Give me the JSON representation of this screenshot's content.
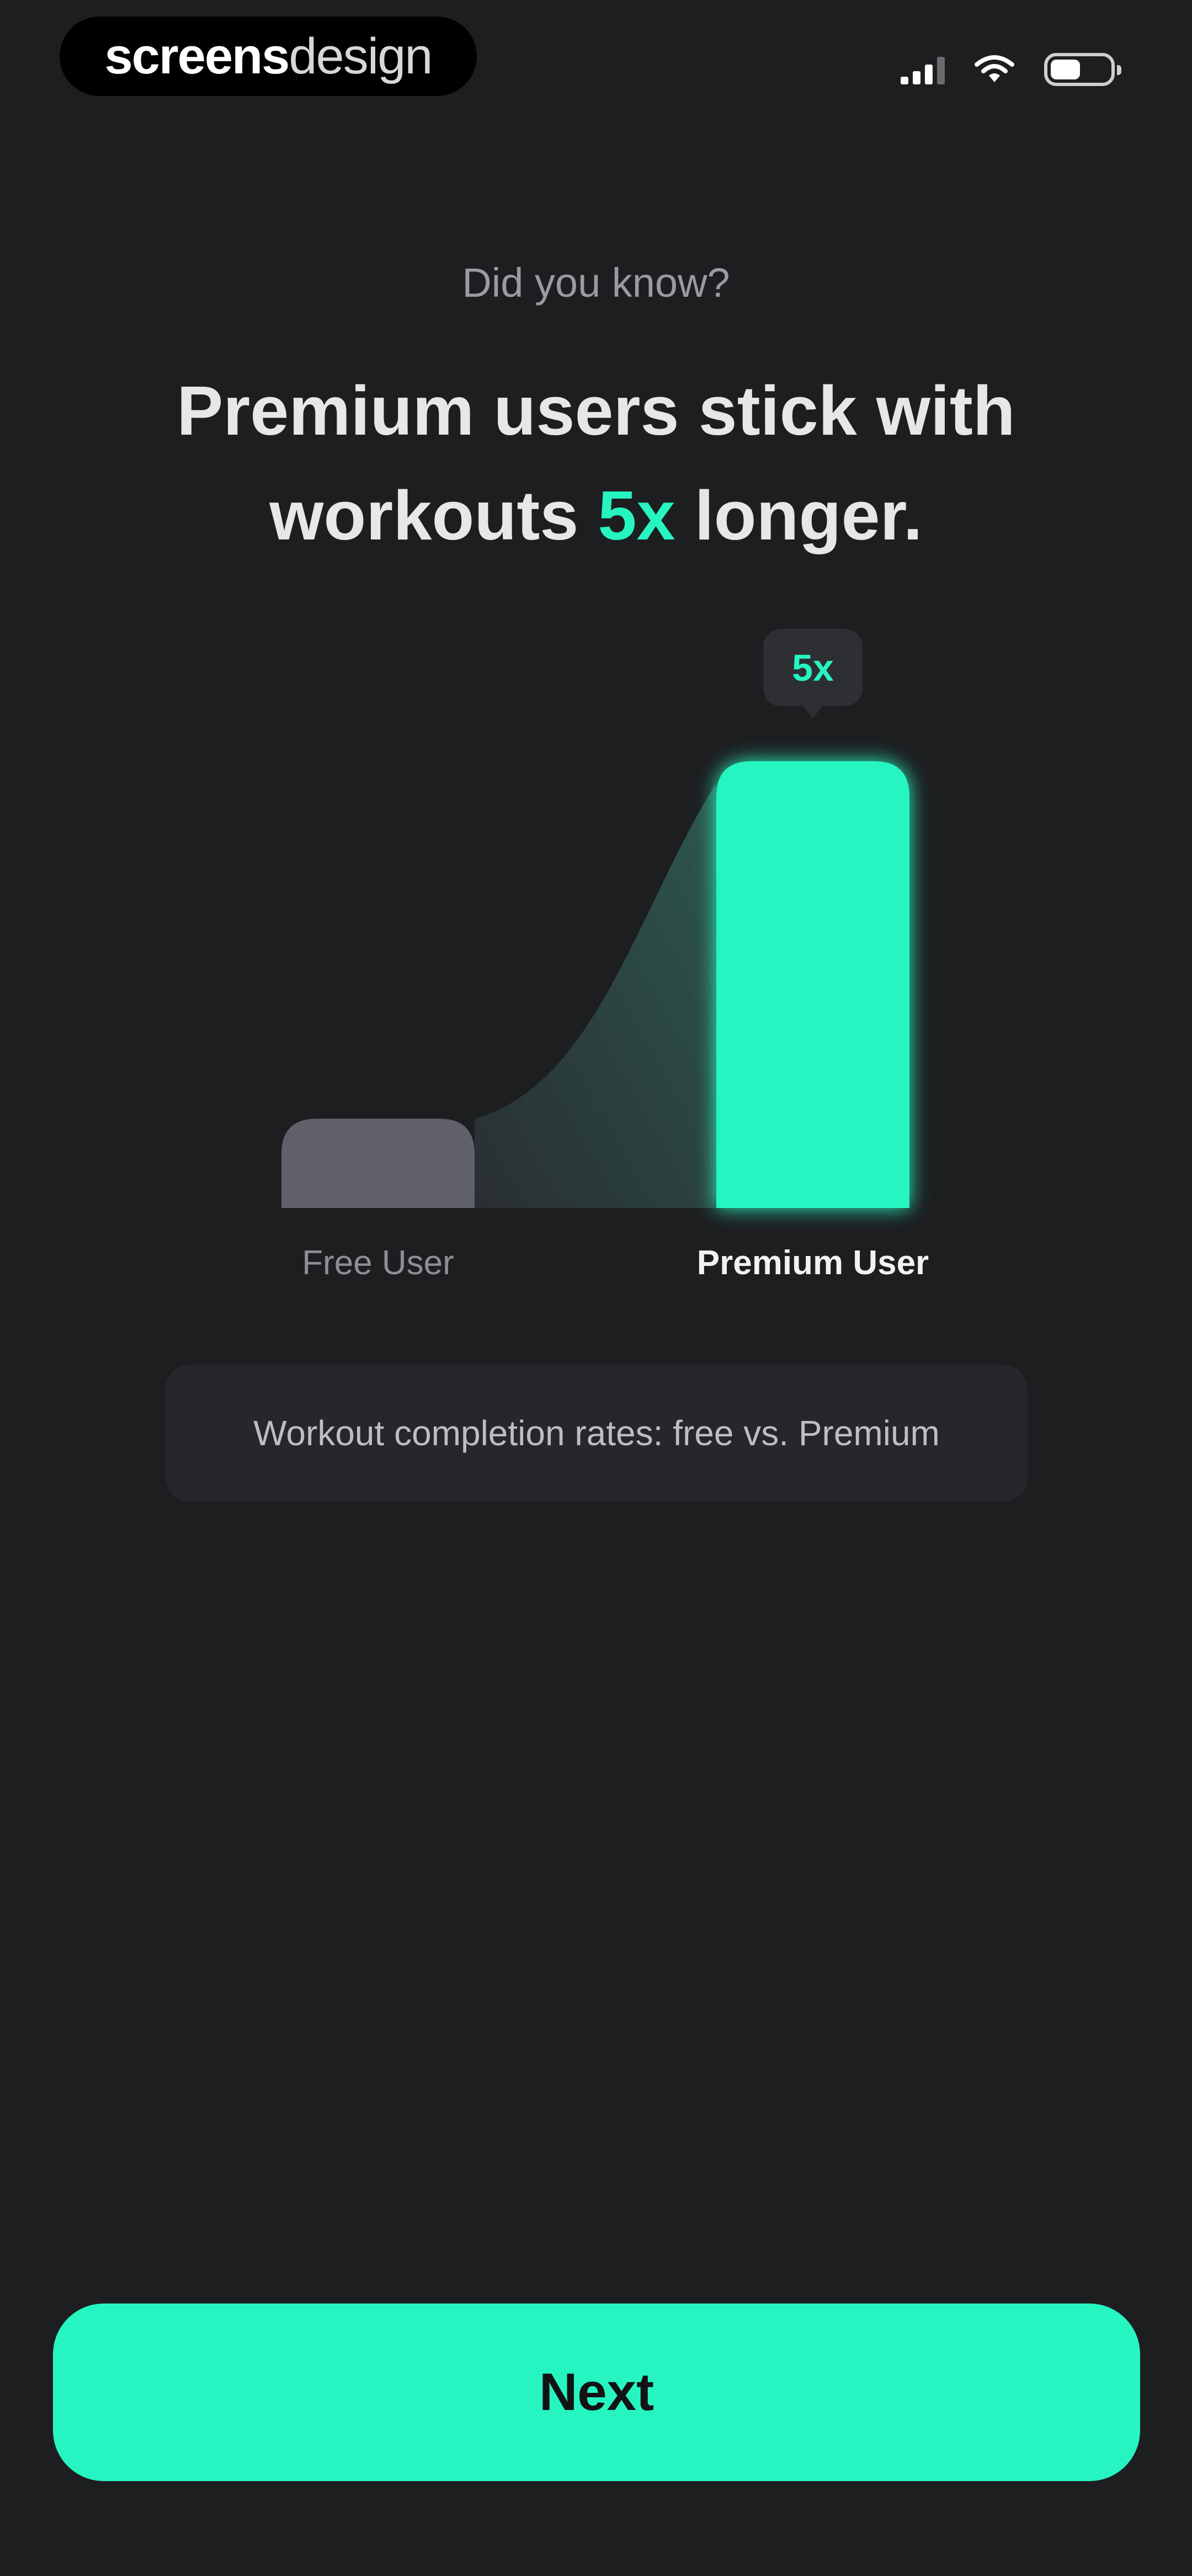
{
  "status_bar": {
    "brand_strong": "screens",
    "brand_light": "design",
    "icons": [
      "cellular-signal-icon",
      "wifi-icon",
      "battery-icon"
    ],
    "battery_level": 0.46
  },
  "intro": {
    "kicker": "Did you know?",
    "headline_part1": "Premium users stick with",
    "headline_part2": "workouts",
    "headline_accent": "5x",
    "headline_part3": "longer."
  },
  "chart_data": {
    "type": "bar",
    "categories": [
      "Free User",
      "Premium User"
    ],
    "values": [
      1,
      5
    ],
    "annotation": "5x",
    "colors": [
      "#5f6069",
      "#26f5c1"
    ]
  },
  "caption": "Workout completion rates: free vs. Premium",
  "cta": {
    "label": "Next"
  },
  "colors": {
    "background": "#1d1e20",
    "accent": "#26f5c1",
    "muted_bar": "#5f6069",
    "caption_bg": "#26272b"
  }
}
